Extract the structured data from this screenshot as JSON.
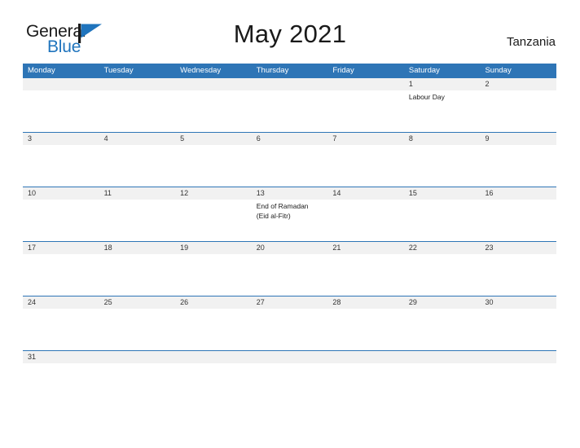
{
  "brand": {
    "name_part1": "General",
    "name_part2": "Blue",
    "flag_icon": "flag-triangle-icon",
    "accent_color": "#1f74bd"
  },
  "header": {
    "title": "May 2021",
    "locale": "Tanzania"
  },
  "theme": {
    "header_blue": "#2e75b6",
    "number_band_gray": "#f1f1f1",
    "page_background": "#ffffff",
    "text_color": "#1a1a1a"
  },
  "calendar": {
    "month": "May",
    "year": "2021",
    "country": "Tanzania",
    "weekdays": [
      "Monday",
      "Tuesday",
      "Wednesday",
      "Thursday",
      "Friday",
      "Saturday",
      "Sunday"
    ],
    "weeks": [
      {
        "days": [
          {
            "num": "",
            "event": ""
          },
          {
            "num": "",
            "event": ""
          },
          {
            "num": "",
            "event": ""
          },
          {
            "num": "",
            "event": ""
          },
          {
            "num": "",
            "event": ""
          },
          {
            "num": "1",
            "event": "Labour Day"
          },
          {
            "num": "2",
            "event": ""
          }
        ]
      },
      {
        "days": [
          {
            "num": "3",
            "event": ""
          },
          {
            "num": "4",
            "event": ""
          },
          {
            "num": "5",
            "event": ""
          },
          {
            "num": "6",
            "event": ""
          },
          {
            "num": "7",
            "event": ""
          },
          {
            "num": "8",
            "event": ""
          },
          {
            "num": "9",
            "event": ""
          }
        ]
      },
      {
        "days": [
          {
            "num": "10",
            "event": ""
          },
          {
            "num": "11",
            "event": ""
          },
          {
            "num": "12",
            "event": ""
          },
          {
            "num": "13",
            "event": "End of Ramadan\n(Eid al-Fitr)"
          },
          {
            "num": "14",
            "event": ""
          },
          {
            "num": "15",
            "event": ""
          },
          {
            "num": "16",
            "event": ""
          }
        ]
      },
      {
        "days": [
          {
            "num": "17",
            "event": ""
          },
          {
            "num": "18",
            "event": ""
          },
          {
            "num": "19",
            "event": ""
          },
          {
            "num": "20",
            "event": ""
          },
          {
            "num": "21",
            "event": ""
          },
          {
            "num": "22",
            "event": ""
          },
          {
            "num": "23",
            "event": ""
          }
        ]
      },
      {
        "days": [
          {
            "num": "24",
            "event": ""
          },
          {
            "num": "25",
            "event": ""
          },
          {
            "num": "26",
            "event": ""
          },
          {
            "num": "27",
            "event": ""
          },
          {
            "num": "28",
            "event": ""
          },
          {
            "num": "29",
            "event": ""
          },
          {
            "num": "30",
            "event": ""
          }
        ]
      },
      {
        "truncated": true,
        "days": [
          {
            "num": "31",
            "event": ""
          },
          {
            "num": "",
            "event": ""
          },
          {
            "num": "",
            "event": ""
          },
          {
            "num": "",
            "event": ""
          },
          {
            "num": "",
            "event": ""
          },
          {
            "num": "",
            "event": ""
          },
          {
            "num": "",
            "event": ""
          }
        ]
      }
    ]
  }
}
